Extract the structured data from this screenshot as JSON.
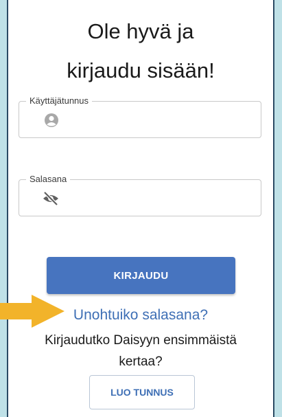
{
  "login": {
    "title_line1": "Ole hyvä ja",
    "title_line2": "kirjaudu sisään!",
    "username_label": "Käyttäjätunnus",
    "password_label": "Salasana",
    "login_button": "KIRJAUDU",
    "forgot_link": "Unohtuiko salasana?",
    "first_time_text": "Kirjaudutko Daisyyn ensimmäistä kertaa?",
    "create_account_button": "LUO TUNNUS"
  },
  "icons": {
    "username": "user-icon",
    "password": "eye-slash-icon",
    "annotation": "arrow-icon"
  },
  "colors": {
    "background": "#bfe1e7",
    "primary": "#4774bf",
    "link": "#3e6fb5",
    "annotation_arrow": "#f2b32a"
  }
}
